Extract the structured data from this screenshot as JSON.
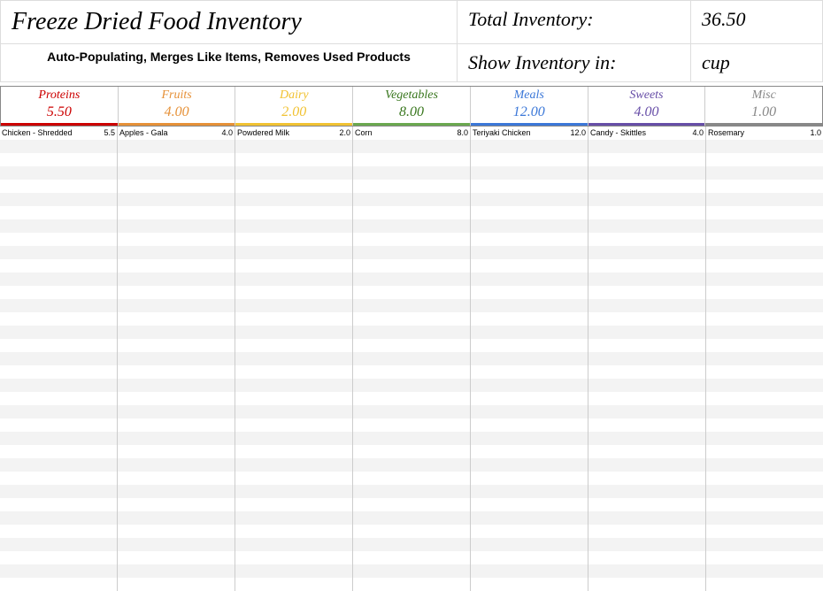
{
  "header": {
    "title": "Freeze Dried Food Inventory",
    "subtitle": "Auto-Populating, Merges Like Items, Removes Used Products",
    "total_label": "Total Inventory:",
    "total_value": "36.50",
    "unit_label": "Show Inventory in:",
    "unit_value": "cup"
  },
  "categories": [
    {
      "name": "Proteins",
      "total": "5.50",
      "color": "#cc0000",
      "underline": "#cc0000"
    },
    {
      "name": "Fruits",
      "total": "4.00",
      "color": "#e69138",
      "underline": "#e69138"
    },
    {
      "name": "Dairy",
      "total": "2.00",
      "color": "#f1c232",
      "underline": "#f1c232"
    },
    {
      "name": "Vegetables",
      "total": "8.00",
      "color": "#38761d",
      "underline": "#6aa84f"
    },
    {
      "name": "Meals",
      "total": "12.00",
      "color": "#3c78d8",
      "underline": "#3c78d8"
    },
    {
      "name": "Sweets",
      "total": "4.00",
      "color": "#674ea7",
      "underline": "#674ea7"
    },
    {
      "name": "Misc",
      "total": "1.00",
      "color": "#888888",
      "underline": "#888888"
    }
  ],
  "items": [
    [
      {
        "name": "Chicken - Shredded",
        "qty": "5.5"
      }
    ],
    [
      {
        "name": "Apples - Gala",
        "qty": "4.0"
      }
    ],
    [
      {
        "name": "Powdered Milk",
        "qty": "2.0"
      }
    ],
    [
      {
        "name": "Corn",
        "qty": "8.0"
      }
    ],
    [
      {
        "name": "Teriyaki Chicken",
        "qty": "12.0"
      }
    ],
    [
      {
        "name": "Candy - Skittles",
        "qty": "4.0"
      }
    ],
    [
      {
        "name": "Rosemary",
        "qty": "1.0"
      }
    ]
  ],
  "empty_rows": 34
}
